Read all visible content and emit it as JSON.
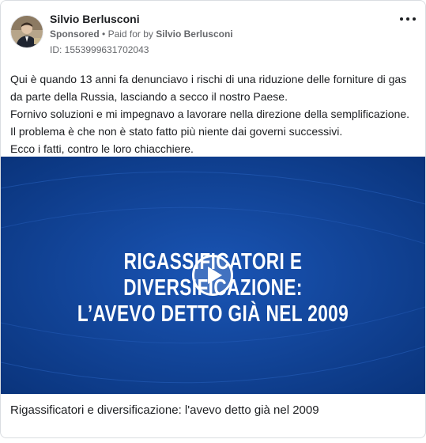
{
  "post": {
    "author": "Silvio Berlusconi",
    "sponsored_label": "Sponsored",
    "separator": "•",
    "paid_prefix": "Paid for by",
    "paid_by": "Silvio Berlusconi",
    "id_line": "ID: 1553999631702043",
    "body_lines": [
      "Qui è quando 13 anni fa denunciavo i rischi di una riduzione delle forniture di gas da parte della Russia, lasciando a secco il nostro Paese.",
      "Fornivo soluzioni e mi impegnavo a lavorare nella direzione della semplificazione.",
      "Il problema è che non è stato fatto più niente dai governi successivi.",
      "Ecco i fatti, contro le loro chiacchiere."
    ]
  },
  "video": {
    "headline_line1": "RIGASSIFICATORI E DIVERSIFICAZIONE:",
    "headline_line2": "L’AVEVO DETTO GIÀ NEL 2009",
    "caption": "Rigassificatori e diversificazione: l'avevo detto già nel 2009"
  },
  "colors": {
    "video_bg": "#0c3d8f",
    "video_light": "#1a55b5",
    "text_primary": "#1c1e21",
    "text_secondary": "#65676b"
  },
  "icons": {
    "more": "more-horizontal-icon",
    "play": "play-icon"
  }
}
